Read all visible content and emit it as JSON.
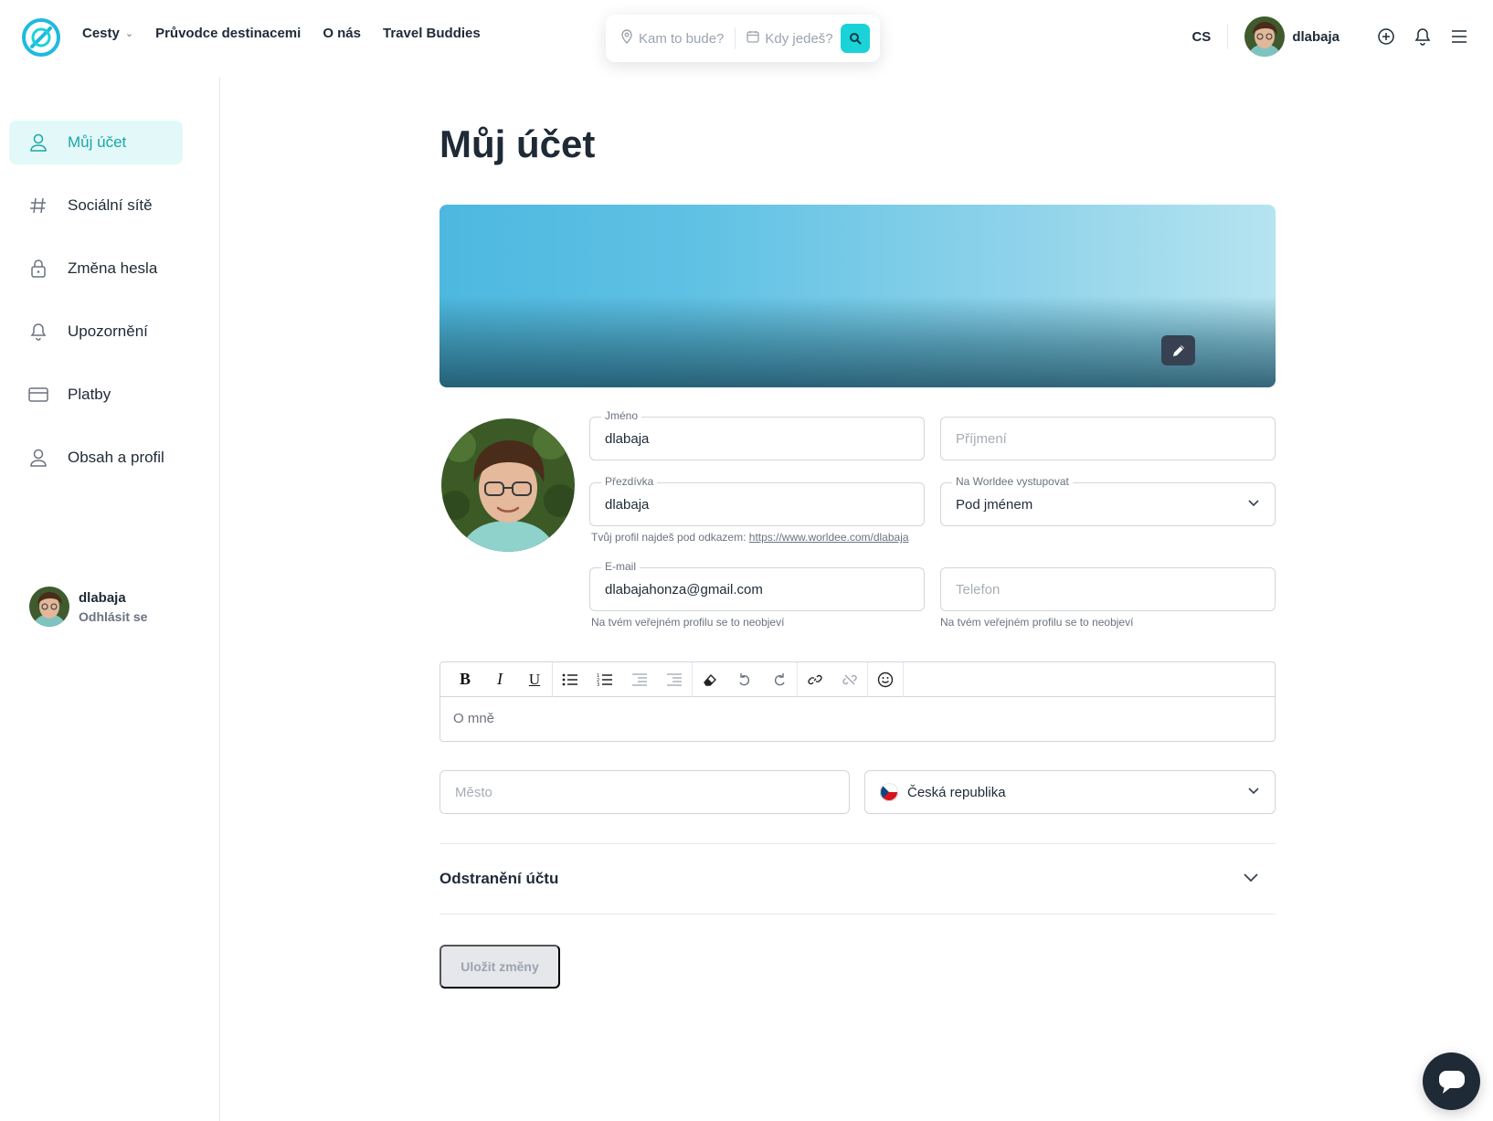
{
  "header": {
    "nav": [
      {
        "label": "Cesty",
        "has_dropdown": true
      },
      {
        "label": "Průvodce destinacemi"
      },
      {
        "label": "O nás"
      },
      {
        "label": "Travel Buddies"
      }
    ],
    "search": {
      "where_placeholder": "Kam to bude?",
      "when_placeholder": "Kdy jedeš?"
    },
    "lang": "CS",
    "username": "dlabaja"
  },
  "sidebar": {
    "items": [
      {
        "label": "Můj účet",
        "icon": "user-icon",
        "active": true
      },
      {
        "label": "Sociální sítě",
        "icon": "hash-icon"
      },
      {
        "label": "Změna hesla",
        "icon": "lock-icon"
      },
      {
        "label": "Upozornění",
        "icon": "bell-icon"
      },
      {
        "label": "Platby",
        "icon": "credit-card-icon"
      },
      {
        "label": "Obsah a profil",
        "icon": "user-icon"
      }
    ],
    "user": {
      "name": "dlabaja",
      "logout": "Odhlásit se"
    }
  },
  "main": {
    "title": "Můj účet",
    "form": {
      "first_name": {
        "label": "Jméno",
        "value": "dlabaja"
      },
      "last_name": {
        "placeholder": "Příjmení"
      },
      "nickname": {
        "label": "Přezdívka",
        "value": "dlabaja"
      },
      "appear_as": {
        "label": "Na Worldee vystupovat",
        "value": "Pod jménem"
      },
      "profile_hint": "Tvůj profil najdeš pod odkazem:",
      "profile_link": "https://www.worldee.com/dlabaja",
      "email": {
        "label": "E-mail",
        "value": "dlabajahonza@gmail.com",
        "hint": "Na tvém veřejném profilu se to neobjeví"
      },
      "phone": {
        "placeholder": "Telefon",
        "hint": "Na tvém veřejném profilu se to neobjeví"
      },
      "about_placeholder": "O mně",
      "city": {
        "placeholder": "Město"
      },
      "country": {
        "value": "Česká republika"
      }
    },
    "delete_account": "Odstranění účtu",
    "save_button": "Uložit změny"
  },
  "colors": {
    "accent": "#19d3d8",
    "active_bg": "#e3f8f8",
    "active_text": "#1aa7a7",
    "text": "#1f2a37"
  }
}
